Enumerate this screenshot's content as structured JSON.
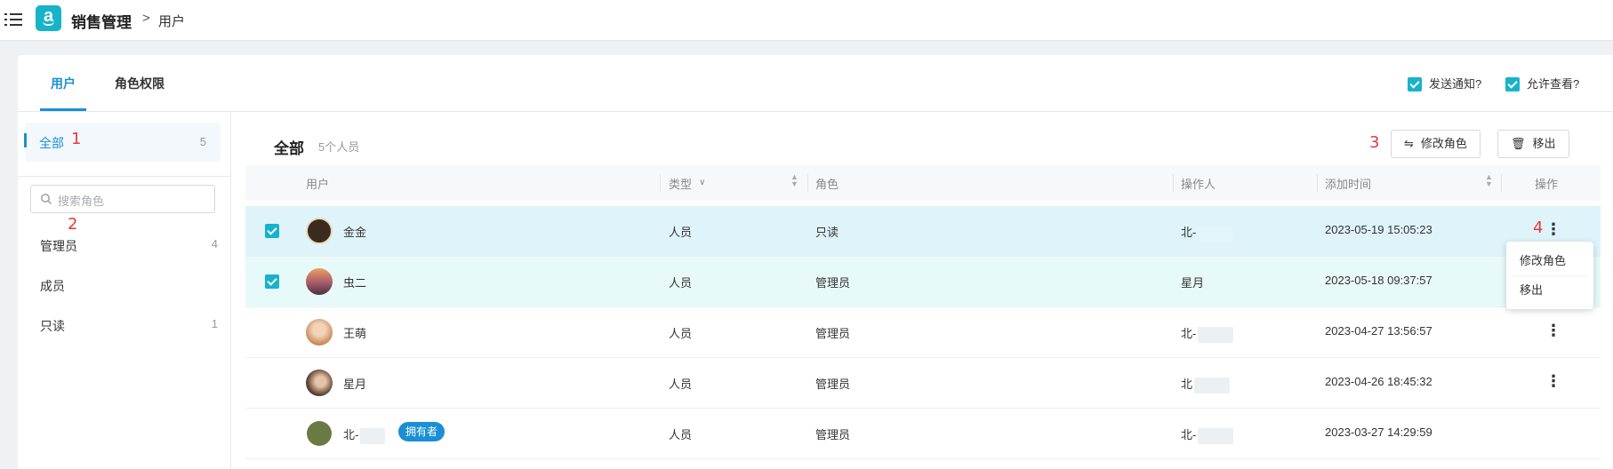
{
  "header": {
    "app_title": "销售管理",
    "breadcrumb_sep": ">",
    "breadcrumb_current": "用户",
    "logo_letter": "a"
  },
  "tabs": [
    {
      "label": "用户",
      "active": true
    },
    {
      "label": "角色权限",
      "active": false
    }
  ],
  "options": {
    "send_notice": {
      "label": "发送通知?",
      "checked": true
    },
    "allow_view": {
      "label": "允许查看?",
      "checked": true
    }
  },
  "sidebar": {
    "all": {
      "label": "全部",
      "count": "5"
    },
    "search_placeholder": "搜索角色",
    "roles": [
      {
        "label": "管理员",
        "count": "4"
      },
      {
        "label": "成员",
        "count": ""
      },
      {
        "label": "只读",
        "count": "1"
      }
    ]
  },
  "markers": [
    "1",
    "2",
    "3",
    "4"
  ],
  "main": {
    "title": "全部",
    "count_text": "5个人员",
    "change_role_label": "修改角色",
    "remove_label": "移出"
  },
  "table": {
    "columns": [
      "用户",
      "类型",
      "角色",
      "操作人",
      "添加时间",
      "操作"
    ],
    "rows": [
      {
        "name": "金金",
        "type": "人员",
        "role": "只读",
        "operator": "北-",
        "time": "2023-05-19 15:05:23",
        "checked": true,
        "avatar_color": "#3b2a1e"
      },
      {
        "name": "虫二",
        "type": "人员",
        "role": "管理员",
        "operator": "星月",
        "time": "2023-05-18 09:37:57",
        "checked": true,
        "avatar_color": "#d48a4a"
      },
      {
        "name": "王萌",
        "type": "人员",
        "role": "管理员",
        "operator": "北-",
        "time": "2023-04-27 13:56:57",
        "checked": false,
        "avatar_color": "#c89a7a"
      },
      {
        "name": "星月",
        "type": "人员",
        "role": "管理员",
        "operator": "北",
        "time": "2023-04-26 18:45:32",
        "checked": false,
        "avatar_color": "#7a5a48"
      },
      {
        "name": "北-",
        "type": "人员",
        "role": "管理员",
        "operator": "北-",
        "time": "2023-03-27 14:29:59",
        "checked": false,
        "avatar_color": "#6b7a45",
        "badge": "拥有者"
      }
    ]
  },
  "row_menu": {
    "items": [
      "修改角色",
      "移出"
    ]
  },
  "colors": {
    "accent": "#1a8fd6",
    "brand": "#17b3c9",
    "marker": "#e63a3a"
  }
}
